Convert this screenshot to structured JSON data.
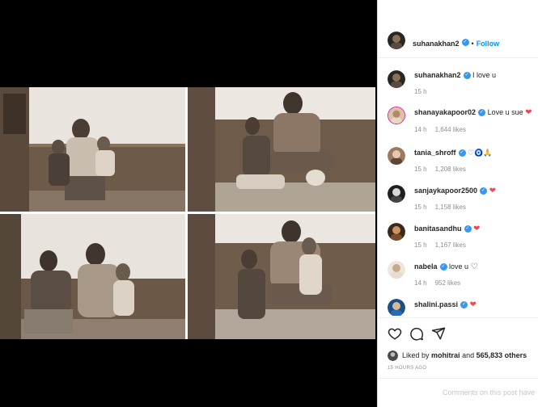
{
  "post": {
    "author": "suhanakhan2",
    "follow_label": "Follow",
    "separator": "•",
    "caption_user": "suhanakhan2",
    "caption_text": "I love u",
    "caption_time": "15 h"
  },
  "comments": [
    {
      "user": "shanayakapoor02",
      "verified": true,
      "text": "Love u sue",
      "emoji": "❤",
      "time": "14 h",
      "likes": "1,644 likes"
    },
    {
      "user": "tania_shroff",
      "verified": true,
      "text": "",
      "emoji": "♡🧿🙏",
      "time": "15 h",
      "likes": "1,208 likes"
    },
    {
      "user": "sanjaykapoor2500",
      "verified": true,
      "text": "",
      "emoji": "❤",
      "time": "15 h",
      "likes": "1,158 likes"
    },
    {
      "user": "banitasandhu",
      "verified": true,
      "text": "",
      "emoji": "❤",
      "time": "15 h",
      "likes": "1,167 likes"
    },
    {
      "user": "nabela",
      "verified": true,
      "text": "love u",
      "emoji": "♡",
      "time": "14 h",
      "likes": "952 likes"
    },
    {
      "user": "shalini.passi",
      "verified": true,
      "text": "",
      "emoji": "❤",
      "time": "",
      "likes": ""
    }
  ],
  "actions": {
    "like_icon": "heart-outline-icon",
    "comment_icon": "comment-bubble-icon",
    "share_icon": "paper-plane-icon",
    "likes_prefix": "Liked by",
    "likes_user": "mohitrai",
    "likes_mid": "and",
    "likes_count": "565,833 others",
    "timestamp": "15 HOURS AGO",
    "add_comment_placeholder": "Comments on this post have"
  },
  "colors": {
    "accent": "#0095f6",
    "verified": "#3897f0",
    "heart": "#ed4956",
    "muted": "#8e8e8e"
  }
}
